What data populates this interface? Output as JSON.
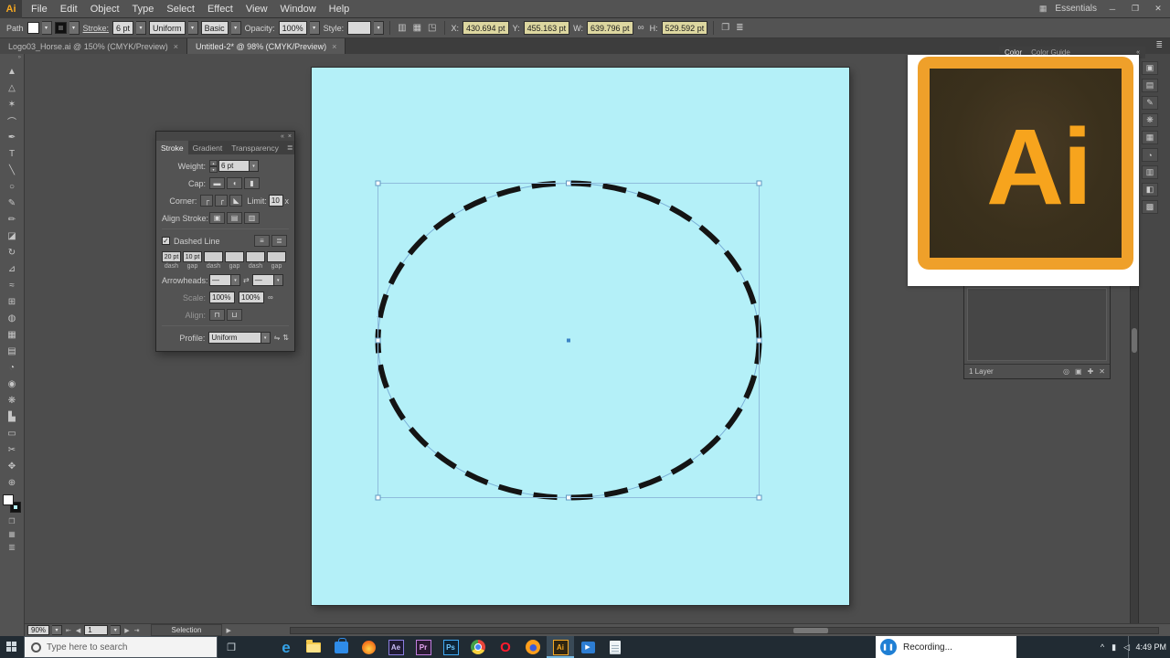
{
  "colors": {
    "artboard": "#b4f0f8",
    "illustrator_orange": "#f6a821",
    "selection_blue": "#6ea6d8",
    "panel_gray": "#535353",
    "canvas_gray": "#4d4d4d",
    "taskbar_dark": "#212b33",
    "recording_accent": "#1f7fd4"
  },
  "icons": {
    "dropdown": "▾",
    "close": "×",
    "collapse_left": "«",
    "collapse_right": "»",
    "menu": "≣",
    "swap": "⇄",
    "link": "∞",
    "flip_h": "⇋",
    "flip_v": "⇅",
    "stepper_up": "▴",
    "stepper_down": "▾",
    "minimize": "─",
    "restore": "❐",
    "close_win": "✕",
    "nav_first": "⇤",
    "nav_prev": "◀",
    "nav_next": "▶",
    "nav_last": "⇥",
    "arrow_right": "▶",
    "grid": "▦",
    "transform_ref": "◳",
    "align_grid": "▥",
    "check": "✓",
    "play": "▶",
    "task_view": "❐",
    "tray_chevron": "^"
  },
  "menubar": {
    "logo": "Ai",
    "items": [
      "File",
      "Edit",
      "Object",
      "Type",
      "Select",
      "Effect",
      "View",
      "Window",
      "Help"
    ],
    "workspace": "Essentials"
  },
  "controlbar": {
    "selection_type": "Path",
    "stroke_label": "Stroke:",
    "stroke_weight": "6 pt",
    "width_profile": "Uniform",
    "brush": "Basic",
    "opacity_label": "Opacity:",
    "opacity_value": "100%",
    "style_label": "Style:",
    "x_label": "X:",
    "x_value": "430.694 pt",
    "y_label": "Y:",
    "y_value": "455.163 pt",
    "w_label": "W:",
    "w_value": "639.796 pt",
    "h_label": "H:",
    "h_value": "529.592 pt"
  },
  "document_tabs": [
    {
      "label": "Logo03_Horse.ai @ 150% (CMYK/Preview)"
    },
    {
      "label": "Untitled-2* @ 98% (CMYK/Preview)"
    }
  ],
  "tools": [
    {
      "name": "selection",
      "glyph": "▲"
    },
    {
      "name": "direct-selection",
      "glyph": "△"
    },
    {
      "name": "magic-wand",
      "glyph": "✶"
    },
    {
      "name": "lasso",
      "glyph": "⌒"
    },
    {
      "name": "pen",
      "glyph": "✒"
    },
    {
      "name": "type",
      "glyph": "T"
    },
    {
      "name": "line",
      "glyph": "╲"
    },
    {
      "name": "ellipse",
      "glyph": "○"
    },
    {
      "name": "paintbrush",
      "glyph": "✎"
    },
    {
      "name": "pencil",
      "glyph": "✏"
    },
    {
      "name": "eraser",
      "glyph": "◪"
    },
    {
      "name": "rotate",
      "glyph": "↻"
    },
    {
      "name": "scale",
      "glyph": "⊿"
    },
    {
      "name": "width",
      "glyph": "≈"
    },
    {
      "name": "free-transform",
      "glyph": "⊞"
    },
    {
      "name": "shape-builder",
      "glyph": "◍"
    },
    {
      "name": "mesh",
      "glyph": "▦"
    },
    {
      "name": "gradient",
      "glyph": "▤"
    },
    {
      "name": "eyedropper",
      "glyph": "◔"
    },
    {
      "name": "blend",
      "glyph": "◉"
    },
    {
      "name": "symbol-sprayer",
      "glyph": "❋"
    },
    {
      "name": "column-graph",
      "glyph": "▙"
    },
    {
      "name": "artboard",
      "glyph": "▭"
    },
    {
      "name": "slice",
      "glyph": "✂"
    },
    {
      "name": "hand",
      "glyph": "✥"
    },
    {
      "name": "zoom",
      "glyph": "⊕"
    }
  ],
  "stroke_panel": {
    "tabs": [
      "Stroke",
      "Gradient",
      "Transparency"
    ],
    "weight_label": "Weight:",
    "weight_value": "6 pt",
    "cap_label": "Cap:",
    "cap_icons": [
      "▬",
      "◖",
      "▮"
    ],
    "corner_label": "Corner:",
    "corner_icons": [
      "┌",
      "╭",
      "◣"
    ],
    "limit_label": "Limit:",
    "limit_value": "10",
    "limit_suffix": "x",
    "align_stroke_label": "Align Stroke:",
    "align_stroke_icons": [
      "▣",
      "▤",
      "▥"
    ],
    "dashed_line_label": "Dashed Line",
    "dashed_toggle_icons": [
      "≡",
      "≣"
    ],
    "dash_values": [
      "20 pt",
      "10 pt",
      "",
      "",
      "",
      ""
    ],
    "dash_field_labels": [
      "dash",
      "gap",
      "dash",
      "gap",
      "dash",
      "gap"
    ],
    "arrowheads_label": "Arrowheads:",
    "arrowhead_value_1": "—",
    "arrowhead_value_2": "—",
    "scale_label": "Scale:",
    "scale_value_1": "100%",
    "scale_value_2": "100%",
    "align_label": "Align:",
    "align_icons": [
      "⊓",
      "⊔"
    ],
    "profile_label": "Profile:",
    "profile_value": "Uniform"
  },
  "right_dock": {
    "panel_tabs": [
      "Color",
      "Color Guide"
    ],
    "icons": [
      "▣",
      "▤",
      "✎",
      "❋",
      "▦",
      "◔",
      "▥",
      "◧",
      "▩"
    ]
  },
  "layers_panel": {
    "status": "1 Layer",
    "icon_glyphs": [
      "◎",
      "▣",
      "✚",
      "✕"
    ]
  },
  "logo_overlay": {
    "text": "Ai"
  },
  "statusbar": {
    "zoom": "90%",
    "artboard_number": "1",
    "status": "Selection"
  },
  "taskbar": {
    "search_placeholder": "Type here to search",
    "recording_label": "Recording...",
    "pause_glyph": "❚❚",
    "time": "4:49 PM",
    "apps": [
      {
        "name": "edge",
        "label": "e"
      },
      {
        "name": "file-explorer",
        "label": ""
      },
      {
        "name": "store",
        "label": ""
      },
      {
        "name": "flame-app",
        "label": ""
      },
      {
        "name": "after-effects",
        "label": "Ae"
      },
      {
        "name": "premiere",
        "label": "Pr"
      },
      {
        "name": "photoshop",
        "label": "Ps"
      },
      {
        "name": "chrome",
        "label": ""
      },
      {
        "name": "opera",
        "label": "O"
      },
      {
        "name": "firefox",
        "label": ""
      },
      {
        "name": "illustrator",
        "label": "Ai"
      },
      {
        "name": "movies-tv",
        "label": ""
      },
      {
        "name": "notepad",
        "label": ""
      }
    ]
  }
}
